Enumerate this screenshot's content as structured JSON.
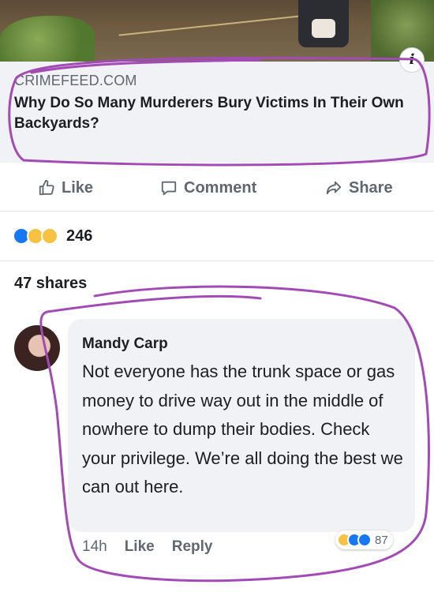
{
  "post": {
    "link": {
      "domain": "CRIMEFEED.COM",
      "title": "Why Do So Many Murderers Bury Victims In Their Own Backyards?",
      "info_icon": "i"
    },
    "actions": {
      "like_label": "Like",
      "comment_label": "Comment",
      "share_label": "Share"
    },
    "reactions": {
      "icons": [
        "like-reaction",
        "wow-reaction",
        "sad-reaction"
      ],
      "count": "246"
    },
    "shares_label": "47 shares"
  },
  "comment": {
    "author": "Mandy Carp",
    "text": "Not everyone has the trunk space or gas money to drive way out in the middle of nowhere to dump their bodies. Check your privilege. We’re all doing the best we can out here.",
    "time": "14h",
    "like_label": "Like",
    "reply_label": "Reply",
    "reactions": {
      "icons": [
        "haha-reaction",
        "like-reaction",
        "love-reaction"
      ],
      "count": "87"
    }
  },
  "colors": {
    "link_bg": "#f0f2f5",
    "muted_text": "#606770",
    "fb_blue": "#1877f2",
    "annotation_purple": "#a24bb4"
  }
}
